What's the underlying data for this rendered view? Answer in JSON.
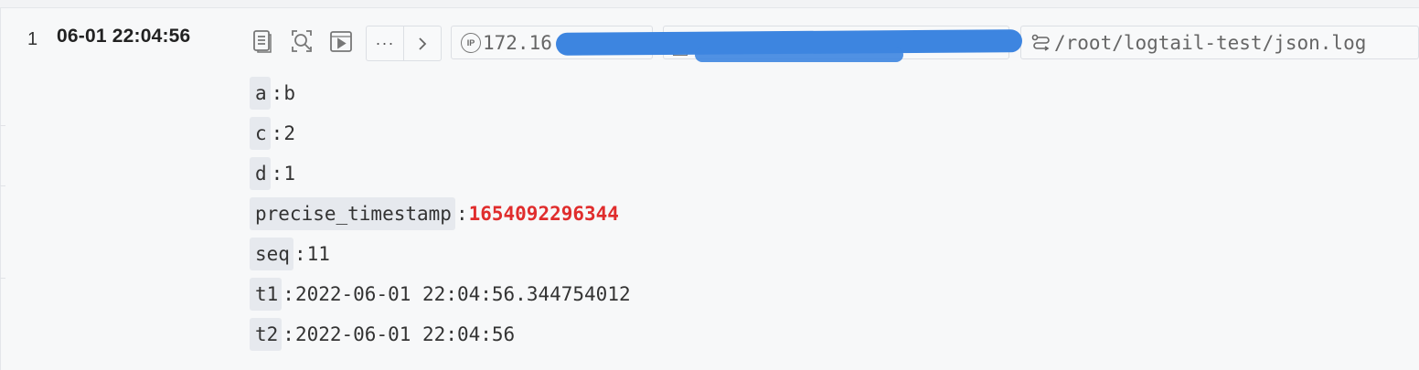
{
  "record": {
    "index": "1",
    "time": "06-01 22:04:56",
    "ip_label": "IP",
    "ip_value_visible": "172.16",
    "source_path": "/root/logtail-test/json.log",
    "actions": [
      {
        "name": "document-icon"
      },
      {
        "name": "context-search-icon"
      },
      {
        "name": "play-icon"
      }
    ],
    "more_label": "···",
    "fields": [
      {
        "key": "a",
        "sep": ":",
        "value": "b",
        "highlight": false
      },
      {
        "key": "c",
        "sep": ":",
        "value": "2",
        "highlight": false
      },
      {
        "key": "d",
        "sep": ":",
        "value": "1",
        "highlight": false
      },
      {
        "key": "precise_timestamp",
        "sep": ":",
        "value": "1654092296344",
        "highlight": true
      },
      {
        "key": "seq",
        "sep": ":",
        "value": "11",
        "highlight": false
      },
      {
        "key": "t1",
        "sep": ":",
        "value": "2022-06-01 22:04:56.344754012",
        "highlight": false
      },
      {
        "key": "t2",
        "sep": ":",
        "value": "2022-06-01 22:04:56",
        "highlight": false
      }
    ]
  },
  "colors": {
    "highlight_value": "#e02d2d",
    "redaction": "#3d85e0"
  }
}
